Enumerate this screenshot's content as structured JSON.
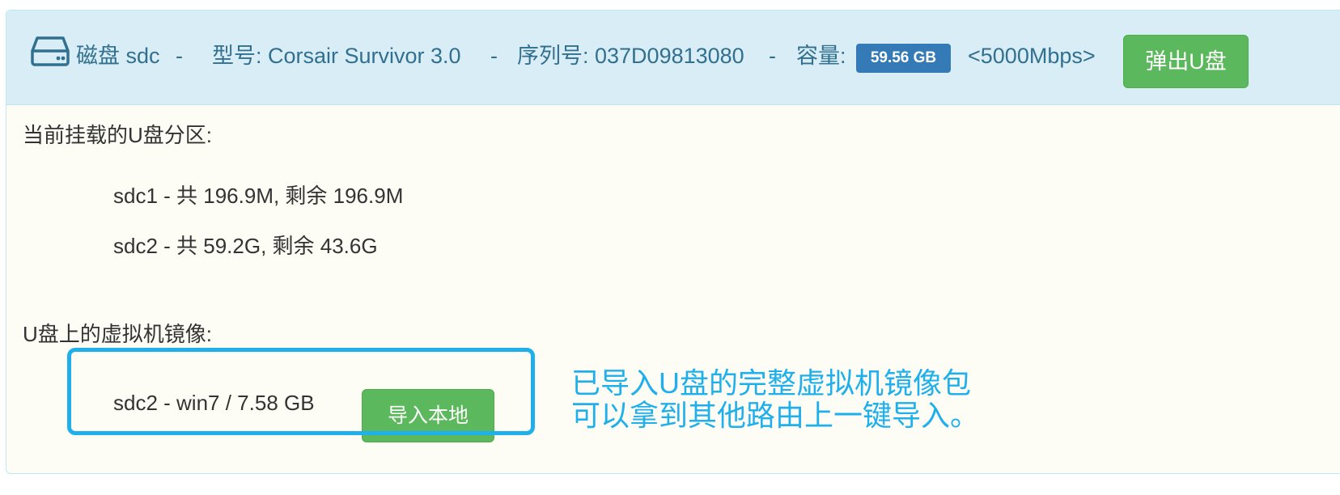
{
  "header": {
    "disk_label": "磁盘 sdc",
    "sep1": "-",
    "model": "型号: Corsair Survivor 3.0",
    "sep2": "-",
    "serial": "序列号: 037D09813080",
    "sep3": "-",
    "capacity_label": "容量:",
    "capacity_badge": "59.56 GB",
    "speed": "<5000Mbps>",
    "eject_button": "弹出U盘",
    "icon": "hdd-icon"
  },
  "partitions": {
    "title": "当前挂载的U盘分区:",
    "items": [
      "sdc1 - 共 196.9M, 剩余 196.9M",
      "sdc2 - 共 59.2G, 剩余 43.6G"
    ]
  },
  "vm_images": {
    "title": "U盘上的虚拟机镜像:",
    "items": [
      {
        "label": "sdc2 - win7 / 7.58 GB",
        "import_button": "导入本地"
      }
    ]
  },
  "annotation": {
    "line1": "已导入U盘的完整虚拟机镜像包",
    "line2": "可以拿到其他路由上一键导入。"
  },
  "colors": {
    "heading_bg": "#d9edf7",
    "heading_text": "#31708f",
    "badge": "#337ab7",
    "button_green": "#5cb85c",
    "highlight": "#1fb0ec"
  }
}
